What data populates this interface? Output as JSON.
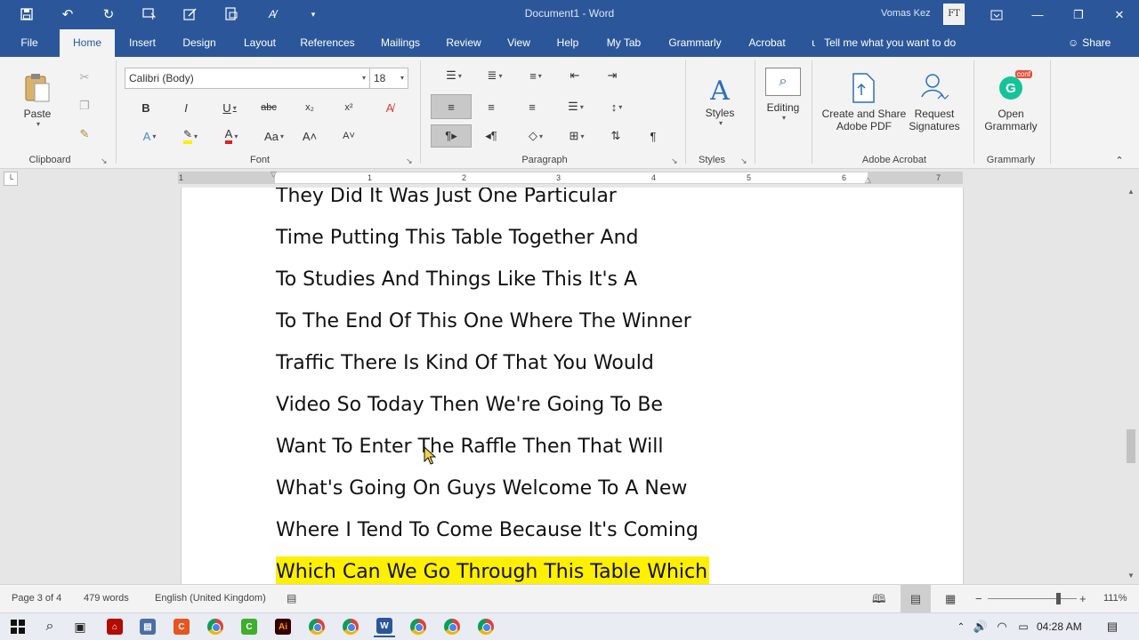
{
  "titlebar": {
    "title": "Document1  -  Word",
    "user": "Vomas Kez",
    "avatar_text": "FT"
  },
  "tabs": [
    "File",
    "Home",
    "Insert",
    "Design",
    "Layout",
    "References",
    "Mailings",
    "Review",
    "View",
    "Help",
    "My Tab",
    "Grammarly",
    "Acrobat"
  ],
  "active_tab": "Home",
  "tell_me": "Tell me what you want to do",
  "share": "Share",
  "clipboard": {
    "paste": "Paste",
    "label": "Clipboard"
  },
  "font": {
    "name": "Calibri (Body)",
    "size": "18",
    "label": "Font"
  },
  "paragraph": {
    "label": "Paragraph"
  },
  "styles": {
    "button": "Styles",
    "label": "Styles"
  },
  "editing": {
    "button": "Editing"
  },
  "acrobat": {
    "create_line1": "Create and Share",
    "create_line2": "Adobe PDF",
    "request_line1": "Request",
    "request_line2": "Signatures",
    "label": "Adobe Acrobat"
  },
  "grammarly": {
    "open_line1": "Open",
    "open_line2": "Grammarly",
    "label": "Grammarly",
    "badge": "conf"
  },
  "ruler": {
    "numbers": [
      "1",
      "1",
      "2",
      "3",
      "4",
      "5",
      "6",
      "7"
    ]
  },
  "document": {
    "lines": [
      "They Did It Was Just One Particular",
      "Time Putting This Table Together And",
      "To Studies And Things Like This It's A",
      "To The End Of This One Where The Winner",
      "Traffic There Is Kind Of That You Would",
      "Video So Today Then We're Going To Be",
      "Want To Enter The Raffle Then That Will",
      "What's Going On Guys Welcome To A New",
      "Where I Tend To Come Because It's Coming",
      "Which Can We Go Through This Table Which"
    ],
    "highlighted_line_index": 9,
    "highlight_color": "#ffef00"
  },
  "status": {
    "page": "Page 3 of 4",
    "words": "479 words",
    "language": "English (United Kingdom)",
    "zoom": "111%",
    "zoom_value": 111
  },
  "taskbar": {
    "time": "04:28 AM"
  },
  "colors": {
    "accent": "#2b579a"
  }
}
